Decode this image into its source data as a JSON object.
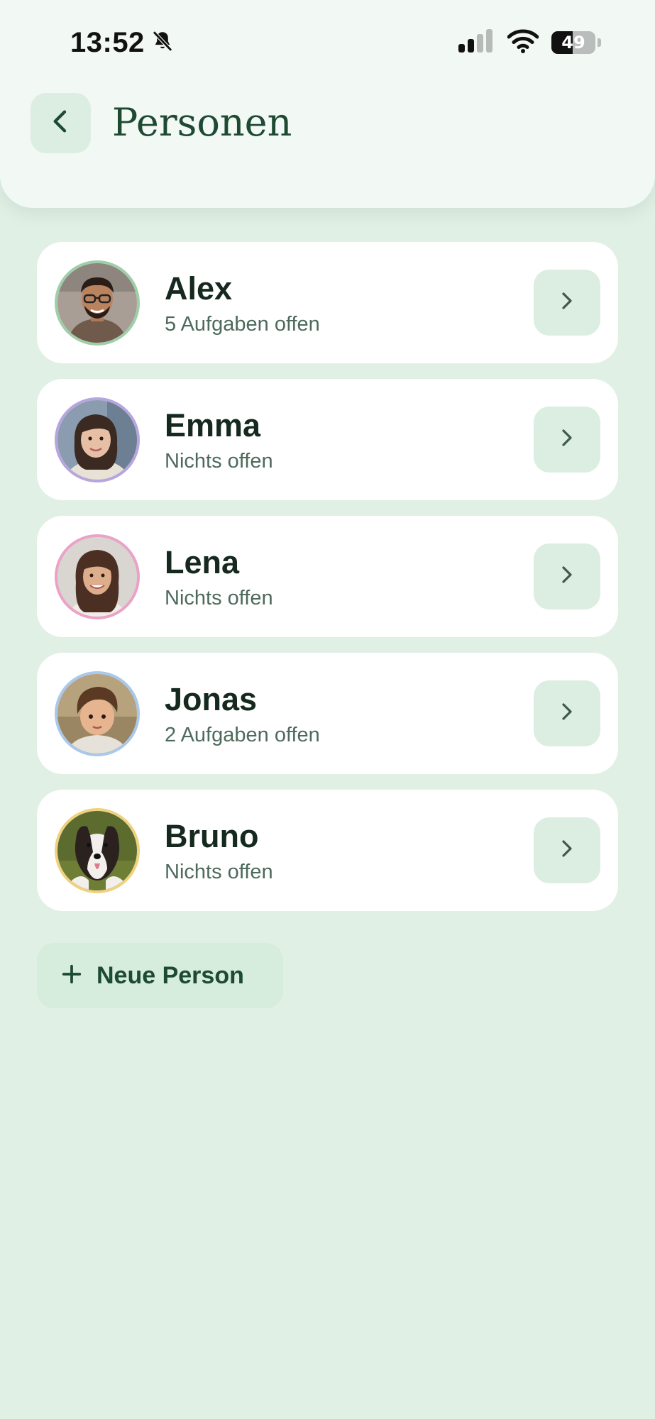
{
  "status_bar": {
    "time": "13:52",
    "battery_percent": 49,
    "battery_text": "49",
    "icons": [
      "bell-slash-icon",
      "cellular-signal-icon",
      "wifi-icon",
      "battery-icon"
    ]
  },
  "header": {
    "title": "Personen",
    "back_icon": "chevron-left-icon"
  },
  "people": [
    {
      "name": "Alex",
      "status": "5 Aufgaben offen",
      "ring_color": "#9fcfa9",
      "avatar": "man-with-glasses-photo"
    },
    {
      "name": "Emma",
      "status": "Nichts offen",
      "ring_color": "#b7a6de",
      "avatar": "girl-photo"
    },
    {
      "name": "Lena",
      "status": "Nichts offen",
      "ring_color": "#eaa2c6",
      "avatar": "woman-photo"
    },
    {
      "name": "Jonas",
      "status": "2 Aufgaben offen",
      "ring_color": "#a9c8ea",
      "avatar": "boy-photo"
    },
    {
      "name": "Bruno",
      "status": "Nichts offen",
      "ring_color": "#efd27f",
      "avatar": "dog-photo"
    }
  ],
  "add_button": {
    "label": "Neue Person",
    "icon": "plus-icon"
  },
  "colors": {
    "background": "#e1f0e5",
    "header_background": "#f2f8f3",
    "accent": "#1e4a33",
    "chip_background": "#dceee2"
  }
}
